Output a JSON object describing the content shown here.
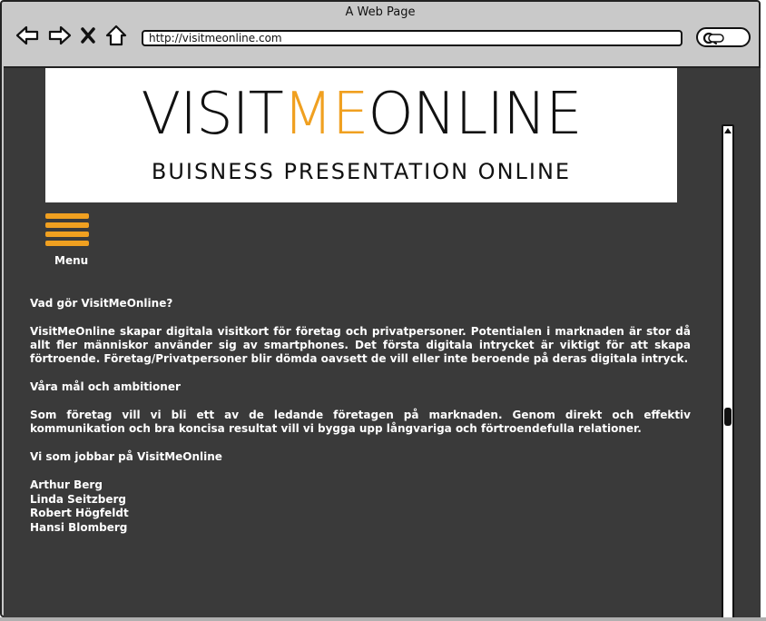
{
  "window": {
    "title": "A Web Page"
  },
  "toolbar": {
    "back_icon": "arrow-left-icon",
    "forward_icon": "arrow-right-icon",
    "stop_icon": "close-icon",
    "home_icon": "home-icon",
    "url": "http://visitmeonline.com",
    "search_icon": "search-icon"
  },
  "banner": {
    "logo_prefix": "VISIT",
    "logo_accent": "ME",
    "logo_suffix": "ONLINE",
    "tagline": "BUISNESS PRESENTATION ONLINE",
    "accent_color": "#f0a020"
  },
  "menu": {
    "label": "Menu",
    "icon": "hamburger-icon"
  },
  "content": {
    "heading1": "Vad gör VisitMeOnline?",
    "paragraph1": "VisitMeOnline skapar digitala visitkort för företag och privatpersoner. Potentialen i marknaden är stor då allt fler människor använder sig av smartphones. Det första digitala intrycket är viktigt för att skapa förtroende. Företag/Privatpersoner blir dömda oavsett de vill eller inte beroende på deras digitala intryck.",
    "heading2": "Våra mål och ambitioner",
    "paragraph2": "Som företag vill vi bli ett av de ledande företagen på marknaden. Genom direkt och effektiv kommunikation och bra koncisa resultat vill vi bygga upp långvariga och förtroendefulla relationer.",
    "heading3": "Vi som jobbar på VisitMeOnline",
    "people": [
      "Arthur Berg",
      "Linda Seitzberg",
      "Robert Högfeldt",
      "Hansi Blomberg"
    ]
  }
}
